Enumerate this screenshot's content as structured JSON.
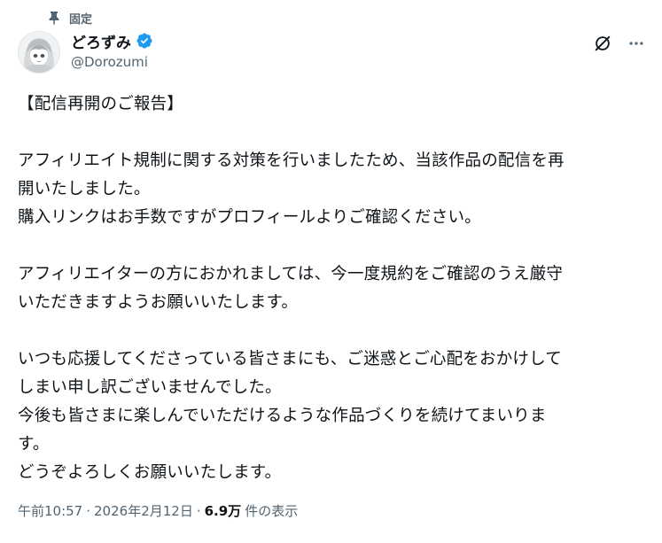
{
  "pinned": {
    "label": "固定"
  },
  "author": {
    "display_name": "どろずみ",
    "handle": "@Dorozumi",
    "verified": true,
    "verified_color": "#1d9bf0"
  },
  "icons": {
    "pinned": "pin-icon",
    "verified": "verified-badge-icon",
    "grok": "grok-icon",
    "more": "more-icon"
  },
  "tweet": {
    "lines": [
      "【配信再開のご報告】",
      "",
      "アフィリエイト規制に関する対策を行いましたため、当該作品の配信を再",
      "開いたしました。",
      "購入リンクはお手数ですがプロフィールよりご確認ください。",
      "",
      "アフィリエイターの方におかれましては、今一度規約をご確認のうえ厳守",
      "いただきますようお願いいたします。",
      "",
      "いつも応援してくださっている皆さまにも、ご迷惑とご心配をおかけして",
      "しまい申し訳ございませんでした。",
      "今後も皆さまに楽しんでいただけるような作品づくりを続けてまいりま",
      "す。",
      "どうぞよろしくお願いいたします。"
    ]
  },
  "meta": {
    "time": "午前10:57",
    "separator": "·",
    "date": "2026年2月12日",
    "views_count": "6.9万",
    "views_label": "件の表示"
  },
  "colors": {
    "text_primary": "#0f1419",
    "text_secondary": "#536471",
    "accent": "#1d9bf0"
  }
}
